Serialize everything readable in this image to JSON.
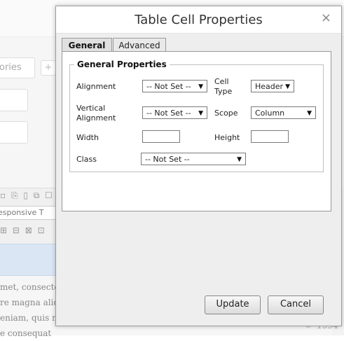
{
  "background": {
    "category_placeholder": "ories",
    "plus_label": "+",
    "style_select_text": "esponsive T",
    "toolbar_icons_row1": "▫ ⎘ ▯ ⧉ ☐",
    "toolbar_icons_row2": "⊞ ⊟ ⊠ ⊡",
    "paragraph_lines": [
      "met, consecte",
      "re magna aliq",
      "eniam, quis n",
      "e consequat"
    ],
    "year": "1994"
  },
  "dialog": {
    "title": "Table Cell Properties",
    "close_glyph": "×",
    "tabs": [
      {
        "label": "General",
        "active": true
      },
      {
        "label": "Advanced",
        "active": false
      }
    ],
    "fieldset_legend": "General Properties",
    "fields": {
      "alignment": {
        "label": "Alignment",
        "value": "-- Not Set --"
      },
      "cell_type": {
        "label": "Cell Type",
        "value": "Header"
      },
      "vertical_alignment": {
        "label": "Vertical Alignment",
        "value": "-- Not Set --"
      },
      "scope": {
        "label": "Scope",
        "value": "Column"
      },
      "width": {
        "label": "Width",
        "value": ""
      },
      "height": {
        "label": "Height",
        "value": ""
      },
      "class": {
        "label": "Class",
        "value": "-- Not Set --"
      }
    },
    "buttons": {
      "update": "Update",
      "cancel": "Cancel"
    },
    "dropdown_arrow": "▼"
  }
}
